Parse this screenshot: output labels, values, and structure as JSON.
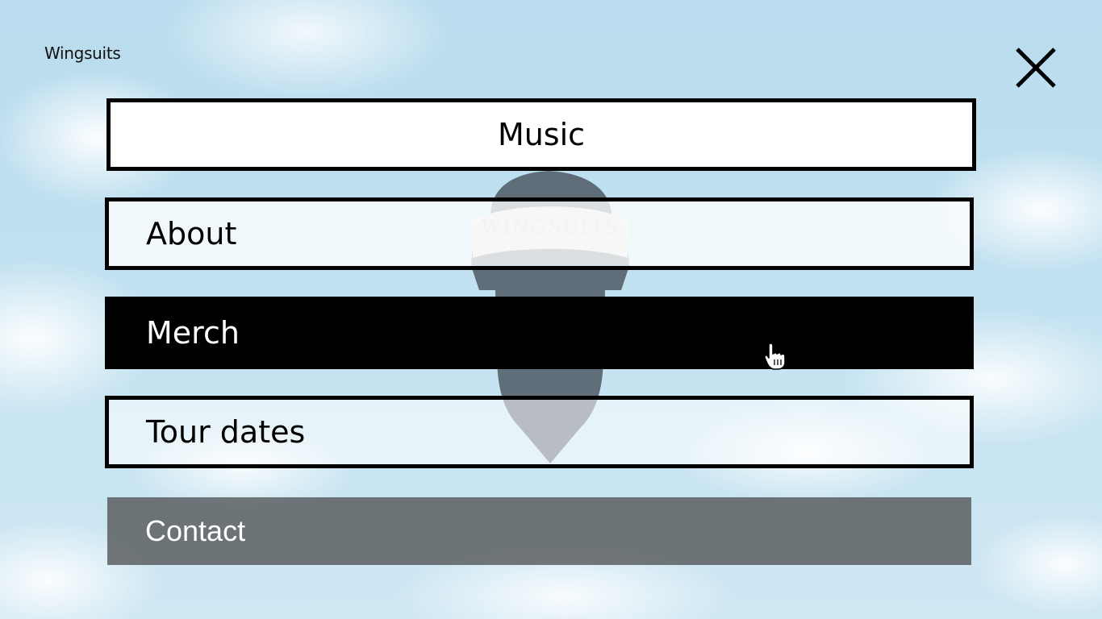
{
  "brand": {
    "name": "Wingsuits"
  },
  "close": {
    "icon": "close-icon"
  },
  "background": {
    "cap_text": "WINGSUITS"
  },
  "menu": {
    "items": [
      {
        "label": "Music",
        "state": "selected"
      },
      {
        "label": "About",
        "state": "default"
      },
      {
        "label": "Merch",
        "state": "hover"
      },
      {
        "label": "Tour dates",
        "state": "default"
      },
      {
        "label": "Contact",
        "state": "pressed"
      }
    ]
  },
  "colors": {
    "sky": "#c3e2f1",
    "border": "#000000",
    "active_bg": "#000000",
    "contact_bg": "#464646"
  },
  "cursor": {
    "icon": "hand-pointer-icon"
  }
}
